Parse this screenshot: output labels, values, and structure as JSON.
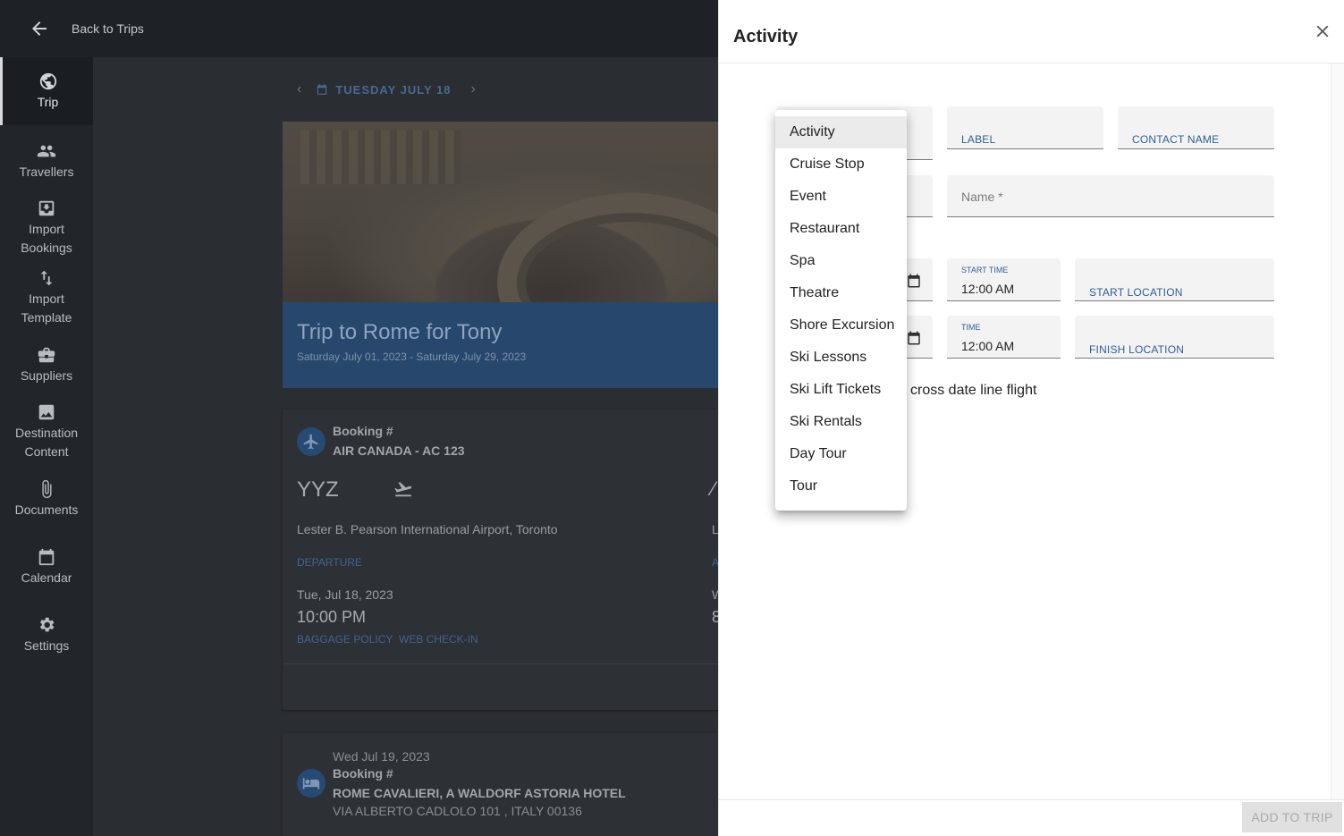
{
  "topbar": {
    "back_label": "Back to Trips"
  },
  "sidebar": {
    "items": [
      {
        "label": "Trip",
        "icon": "globe-icon"
      },
      {
        "label": "Travellers",
        "icon": "people-icon"
      },
      {
        "label": "Import Bookings",
        "icon": "import-icon"
      },
      {
        "label": "Import Template",
        "icon": "swap-vertical-icon"
      },
      {
        "label": "Suppliers",
        "icon": "briefcase-icon"
      },
      {
        "label": "Destination Content",
        "icon": "image-icon"
      },
      {
        "label": "Documents",
        "icon": "paperclip-icon"
      },
      {
        "label": "Calendar",
        "icon": "calendar-icon"
      },
      {
        "label": "Settings",
        "icon": "gear-icon"
      }
    ]
  },
  "main": {
    "date": "TUESDAY JULY 18",
    "trip": {
      "title": "Trip to Rome for Tony",
      "dates": "Saturday July 01, 2023 - Saturday July 29, 2023"
    },
    "flight": {
      "booking_label": "Booking #",
      "airline": "AIR CANADA - AC 123",
      "origin_code": "YYZ",
      "origin_airport": "Lester B. Pearson International Airport, Toronto",
      "departure_label": "DEPARTURE",
      "departure_date": "Tue, Jul 18, 2023",
      "departure_time": "10:00 PM",
      "baggage_link": "BAGGAGE POLICY",
      "checkin_link": "WEB CHECK-IN",
      "partial_dest_airport": "L",
      "partial_arrival_label": "A",
      "partial_arrival_date": "W",
      "partial_arrival_time": "8"
    },
    "hotel": {
      "date": "Wed Jul 19, 2023",
      "booking_label": "Booking #",
      "name": "ROME CAVALIERI, A WALDORF ASTORIA HOTEL",
      "address": "VIA ALBERTO CADLOLO 101 , ITALY 00136"
    }
  },
  "drawer": {
    "title": "Activity",
    "label_field": "LABEL",
    "contact_field": "CONTACT NAME",
    "name_placeholder": "Name *",
    "start_time_label": "START TIME",
    "start_time_value": "12:00 AM",
    "start_location_label": "START LOCATION",
    "finish_time_label": "TIME",
    "finish_time_value": "12:00 AM",
    "finish_location_label": "FINISH LOCATION",
    "checkbox_label": "cross date line flight",
    "add_button": "ADD TO TRIP"
  },
  "menu": {
    "selected": "Activity",
    "options": [
      "Activity",
      "Cruise Stop",
      "Event",
      "Restaurant",
      "Spa",
      "Theatre",
      "Shore Excursion",
      "Ski Lessons",
      "Ski Lift Tickets",
      "Ski Rentals",
      "Day Tour",
      "Tour"
    ]
  },
  "colors": {
    "primary_blue": "#2f5e94",
    "sidebar_bg": "#22262b",
    "overlay_band": "#27476c"
  }
}
